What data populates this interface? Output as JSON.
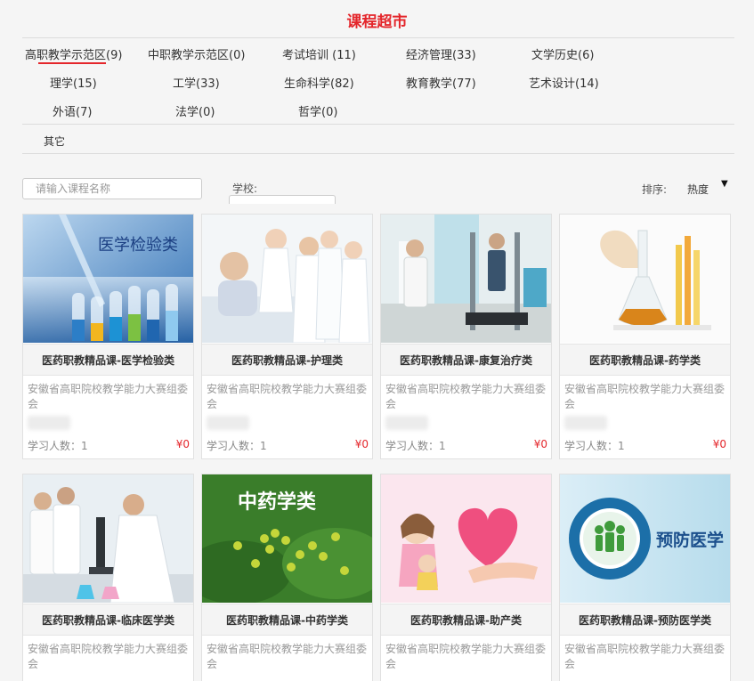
{
  "header": {
    "title": "课程超市"
  },
  "categories": [
    {
      "label": "高职教学示范区(9)",
      "active": true
    },
    {
      "label": "中职教学示范区(0)"
    },
    {
      "label": "考试培训 (11)"
    },
    {
      "label": "经济管理(33)"
    },
    {
      "label": "文学历史(6)"
    },
    {
      "label": "理学(15)"
    },
    {
      "label": "工学(33)"
    },
    {
      "label": "生命科学(82)"
    },
    {
      "label": "教育教学(77)"
    },
    {
      "label": "艺术设计(14)"
    },
    {
      "label": "外语(7)"
    },
    {
      "label": "法学(0)"
    },
    {
      "label": "哲学(0)"
    },
    {
      "label": "其它"
    }
  ],
  "filters": {
    "search_placeholder": "请输入课程名称",
    "school_label": "学校:",
    "sort_label": "排序:",
    "sort_value": "热度"
  },
  "accent_color": "#e4262b",
  "courses": [
    {
      "title": "医药职教精品课-医学检验类",
      "org": "安徽省高职院校教学能力大赛组委会",
      "learners": "学习人数：1",
      "price": "¥0",
      "image_text": "医学检验类",
      "image_icon": "test-tubes-image"
    },
    {
      "title": "医药职教精品课-护理类",
      "org": "安徽省高职院校教学能力大赛组委会",
      "learners": "学习人数：1",
      "price": "¥0",
      "image_text": "",
      "image_icon": "nurses-patient-image"
    },
    {
      "title": "医药职教精品课-康复治疗类",
      "org": "安徽省高职院校教学能力大赛组委会",
      "learners": "学习人数：1",
      "price": "¥0",
      "image_text": "",
      "image_icon": "rehab-room-image"
    },
    {
      "title": "医药职教精品课-药学类",
      "org": "安徽省高职院校教学能力大赛组委会",
      "learners": "学习人数：1",
      "price": "¥0",
      "image_text": "",
      "image_icon": "flask-image"
    },
    {
      "title": "医药职教精品课-临床医学类",
      "org": "安徽省高职院校教学能力大赛组委会",
      "learners": "",
      "price": "",
      "image_text": "",
      "image_icon": "microscope-lab-image"
    },
    {
      "title": "医药职教精品课-中药学类",
      "org": "安徽省高职院校教学能力大赛组委会",
      "learners": "",
      "price": "",
      "image_text": "中药学类",
      "image_icon": "herb-plant-image"
    },
    {
      "title": "医药职教精品课-助产类",
      "org": "安徽省高职院校教学能力大赛组委会",
      "learners": "",
      "price": "",
      "image_text": "",
      "image_icon": "mother-heart-image"
    },
    {
      "title": "医药职教精品课-预防医学类",
      "org": "安徽省高职院校教学能力大赛组委会",
      "learners": "",
      "price": "",
      "image_text": "预防医学",
      "image_icon": "prevention-seal-image"
    }
  ]
}
